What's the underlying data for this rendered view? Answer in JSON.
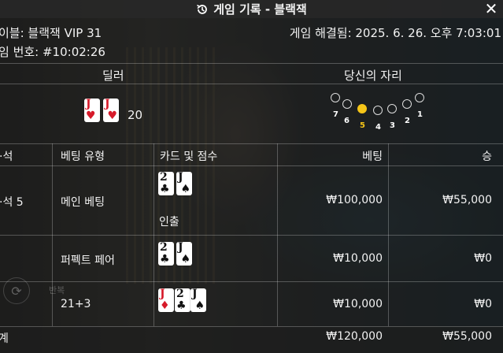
{
  "title": "게임 기록 - 블랙잭",
  "info": {
    "table": "이블: 블랙잭 VIP 31",
    "round": "임 번호: #10:02:26",
    "resolved": "게임 해결됨: 2025. 6. 26. 오후 7:03:01"
  },
  "dealer": {
    "label": "딜러",
    "cards": [
      {
        "rank": "J",
        "suit": "♥",
        "color": "red"
      },
      {
        "rank": "J",
        "suit": "♥",
        "color": "red"
      }
    ],
    "score": "20"
  },
  "seats": {
    "label": "당신의 자리",
    "numbers": [
      "7",
      "6",
      "5",
      "4",
      "3",
      "2",
      "1"
    ],
    "active": "5"
  },
  "table": {
    "headers": [
      "·석",
      "베팅 유형",
      "카드 및 점수",
      "베팅",
      "승"
    ],
    "rows": [
      {
        "seat": "·석 5",
        "type": "메인 베팅",
        "cards": [
          "2",
          "J"
        ],
        "note": "인출",
        "bet": "₩100,000",
        "win": "₩55,000"
      },
      {
        "seat": "",
        "type": "퍼펙트 페어",
        "cards": [
          "2",
          "J"
        ],
        "note": "",
        "bet": "₩10,000",
        "win": "₩0"
      },
      {
        "seat": "",
        "type": "21+3",
        "cards": [
          "J",
          "2",
          "J"
        ],
        "note": "",
        "bet": "₩10,000",
        "win": "₩0"
      }
    ],
    "total": {
      "label": "계",
      "bet": "₩120,000",
      "win": "₩55,000"
    }
  },
  "background": {
    "repeat_label": "반복"
  }
}
